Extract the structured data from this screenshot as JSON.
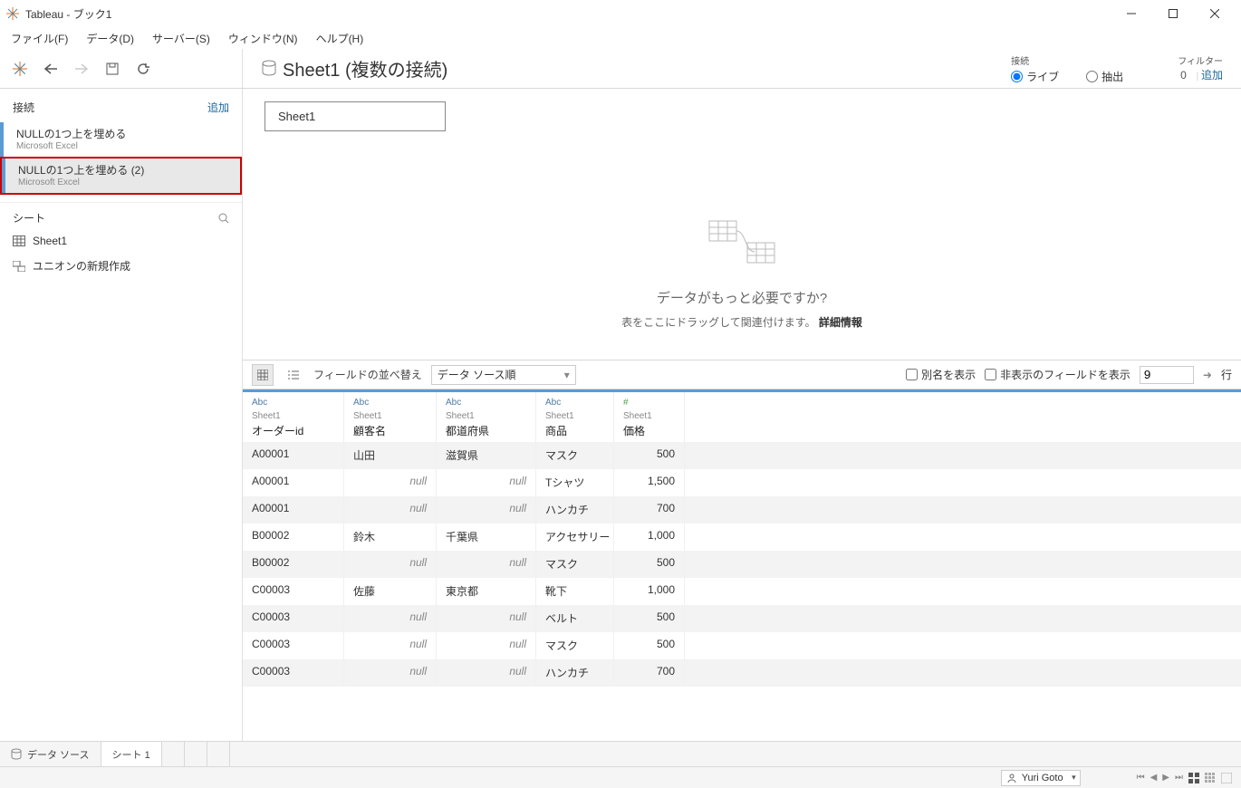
{
  "window": {
    "title": "Tableau - ブック1"
  },
  "menu": {
    "file": "ファイル(F)",
    "data": "データ(D)",
    "server": "サーバー(S)",
    "window": "ウィンドウ(N)",
    "help": "ヘルプ(H)"
  },
  "datasource": {
    "title": "Sheet1 (複数の接続)",
    "connection_label": "接続",
    "live": "ライブ",
    "extract": "抽出",
    "filter_label": "フィルター",
    "filter_count": "0",
    "filter_add": "追加"
  },
  "sidebar": {
    "connections_label": "接続",
    "add": "追加",
    "connections": [
      {
        "name": "NULLの1つ上を埋める",
        "type": "Microsoft Excel"
      },
      {
        "name": "NULLの1つ上を埋める (2)",
        "type": "Microsoft Excel"
      }
    ],
    "sheets_label": "シート",
    "sheet1": "Sheet1",
    "union": "ユニオンの新規作成"
  },
  "canvas": {
    "table_pill": "Sheet1",
    "need_more": "データがもっと必要ですか?",
    "drag_hint": "表をここにドラッグして関連付けます。",
    "learn_more": "詳細情報"
  },
  "grid_toolbar": {
    "sort_label": "フィールドの並べ替え",
    "sort_value": "データ ソース順",
    "alias": "別名を表示",
    "hidden": "非表示のフィールドを表示",
    "row_count": "9",
    "rows_suffix": "行"
  },
  "columns": [
    {
      "type": "Abc",
      "src": "Sheet1",
      "name": "オーダーid"
    },
    {
      "type": "Abc",
      "src": "Sheet1",
      "name": "顧客名"
    },
    {
      "type": "Abc",
      "src": "Sheet1",
      "name": "都道府県"
    },
    {
      "type": "Abc",
      "src": "Sheet1",
      "name": "商品"
    },
    {
      "type": "#",
      "src": "Sheet1",
      "name": "価格"
    }
  ],
  "rows": [
    [
      "A00001",
      "山田",
      "滋賀県",
      "マスク",
      "500"
    ],
    [
      "A00001",
      null,
      null,
      "Tシャツ",
      "1,500"
    ],
    [
      "A00001",
      null,
      null,
      "ハンカチ",
      "700"
    ],
    [
      "B00002",
      "鈴木",
      "千葉県",
      "アクセサリー",
      "1,000"
    ],
    [
      "B00002",
      null,
      null,
      "マスク",
      "500"
    ],
    [
      "C00003",
      "佐藤",
      "東京都",
      "靴下",
      "1,000"
    ],
    [
      "C00003",
      null,
      null,
      "ベルト",
      "500"
    ],
    [
      "C00003",
      null,
      null,
      "マスク",
      "500"
    ],
    [
      "C00003",
      null,
      null,
      "ハンカチ",
      "700"
    ]
  ],
  "tabs": {
    "datasource": "データ ソース",
    "sheet1": "シート 1"
  },
  "status": {
    "user": "Yuri Goto"
  },
  "null_text": "null"
}
